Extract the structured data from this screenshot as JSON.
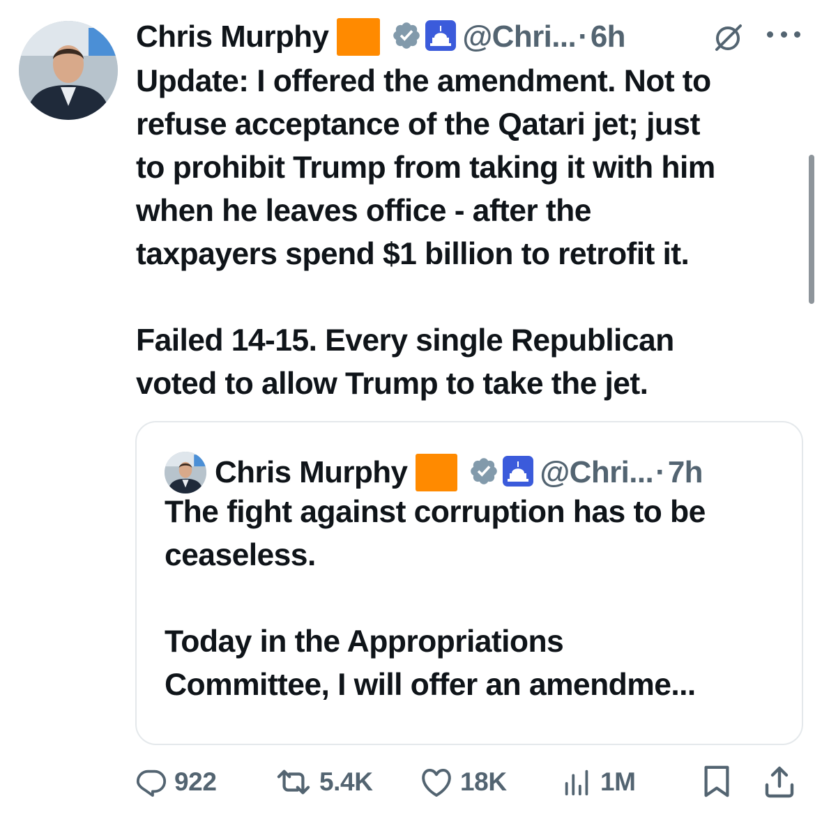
{
  "tweet": {
    "author_name": "Chris Murphy",
    "handle": "@Chri...",
    "dot": "·",
    "time": "6h",
    "icons": {
      "avatar": "avatar-photo",
      "flag": "orange-square-emoji",
      "verified": "verified-badge-icon",
      "gov": "capitol-building-icon",
      "grok": "grok-icon",
      "more": "more-icon"
    },
    "paragraphs": [
      "Update: I offered the amendment. Not to\nrefuse acceptance of the Qatari jet; just\nto prohibit Trump from taking it with him\nwhen he leaves office - after the\ntaxpayers spend $1 billion to retrofit it.",
      "Failed 14-15. Every single Republican\nvoted to allow Trump to take the jet."
    ]
  },
  "quoted_tweet": {
    "author_name": "Chris Murphy",
    "handle": "@Chri...",
    "dot": "·",
    "time": "7h",
    "paragraphs": [
      "The fight against corruption has to be\nceaseless.",
      "Today in the Appropriations\nCommittee, I will offer an amendme..."
    ]
  },
  "actions": {
    "replies": "922",
    "reposts": "5.4K",
    "likes": "18K",
    "views": "1M"
  },
  "colors": {
    "text": "#0f1419",
    "secondary": "#536471",
    "border": "#e4e8eb",
    "verified_blue": "#829aab",
    "flag_orange": "#ff8a00"
  }
}
